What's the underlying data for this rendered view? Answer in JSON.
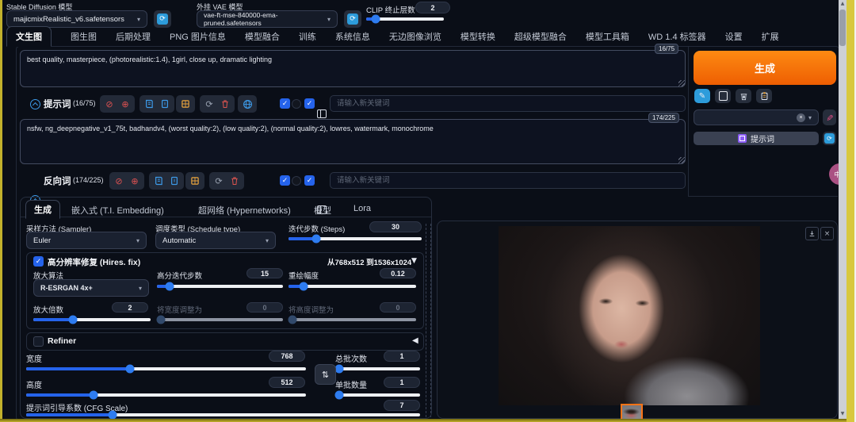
{
  "header": {
    "sd_model_label": "Stable Diffusion 模型",
    "sd_model_value": "majicmixRealistic_v6.safetensors",
    "vae_label": "外挂 VAE 模型",
    "vae_value": "vae-ft-mse-840000-ema-pruned.safetensors",
    "clip_label": "CLIP 终止层数",
    "clip_value": "2"
  },
  "tabs": [
    "文生图",
    "图生图",
    "后期处理",
    "PNG 图片信息",
    "模型融合",
    "训练",
    "系统信息",
    "无边图像浏览",
    "模型转换",
    "超级模型融合",
    "模型工具箱",
    "WD 1.4 标签器",
    "设置",
    "扩展"
  ],
  "prompt": {
    "text": "best quality, masterpiece, (photorealistic:1.4), 1girl, close up, dramatic lighting",
    "badge": "16/75",
    "label": "提示词",
    "counter": "(16/75)",
    "keyword_placeholder": "请输入新关键词"
  },
  "negative": {
    "text": "nsfw, ng_deepnegative_v1_75t, badhandv4, (worst quality:2), (low quality:2), (normal quality:2), lowres, watermark, monochrome",
    "badge": "174/225",
    "label": "反向词",
    "counter": "(174/225)",
    "keyword_placeholder": "请输入新关键词"
  },
  "right_panel": {
    "generate_label": "生成",
    "styles_button_label": "提示词",
    "ime_badge": "中A"
  },
  "subtabs": [
    "生成",
    "嵌入式 (T.I. Embedding)",
    "超网络 (Hypernetworks)",
    "模型",
    "Lora"
  ],
  "settings": {
    "sampler_label": "采样方法 (Sampler)",
    "sampler_value": "Euler",
    "schedule_label": "调度类型 (Schedule type)",
    "schedule_value": "Automatic",
    "steps_label": "迭代步数 (Steps)",
    "steps_value": "30",
    "hires": {
      "title": "高分辨率修复 (Hires. fix)",
      "resolution_info": "从768x512 到1536x1024",
      "upscaler_label": "放大算法",
      "upscaler_value": "R-ESRGAN 4x+",
      "hires_steps_label": "高分迭代步数",
      "hires_steps_value": "15",
      "denoising_label": "重绘幅度",
      "denoising_value": "0.12",
      "upscale_by_label": "放大倍数",
      "upscale_by_value": "2",
      "resize_w_label": "将宽度调整为",
      "resize_w_value": "0",
      "resize_h_label": "将高度调整为",
      "resize_h_value": "0"
    },
    "refiner_label": "Refiner",
    "width_label": "宽度",
    "width_value": "768",
    "height_label": "高度",
    "height_value": "512",
    "batch_count_label": "总批次数",
    "batch_count_value": "1",
    "batch_size_label": "单批数量",
    "batch_size_value": "1",
    "cfg_label": "提示词引导系数 (CFG Scale)",
    "cfg_value": "7"
  },
  "colors": {
    "accent_orange": "#f97316",
    "accent_blue": "#2563eb",
    "refresh_blue": "#2d9cdb",
    "window_border_yellow": "#c2b12c"
  }
}
